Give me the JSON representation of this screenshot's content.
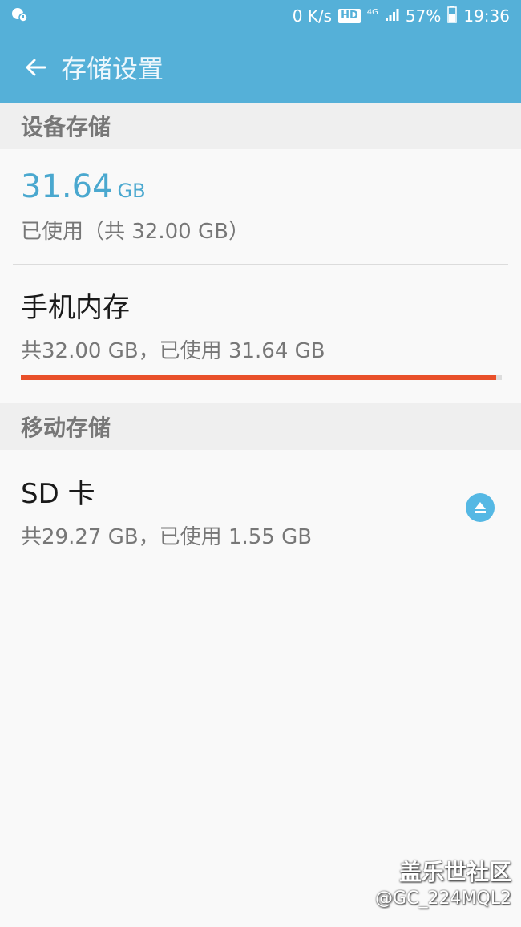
{
  "status_bar": {
    "speed": "0 K/s",
    "hd": "HD",
    "network": "4G",
    "battery": "57%",
    "time": "19:36"
  },
  "app_bar": {
    "title": "存储设置"
  },
  "sections": {
    "device": "设备存储",
    "removable": "移动存储"
  },
  "device_storage": {
    "used_value": "31.64",
    "used_unit": "GB",
    "used_label": "已使用（共 32.00 GB）"
  },
  "phone_memory": {
    "title": "手机内存",
    "detail": "共32.00 GB，已使用 31.64 GB",
    "used_fraction": 0.989
  },
  "sd_card": {
    "title": "SD 卡",
    "detail": "共29.27 GB，已使用 1.55 GB"
  },
  "watermark": {
    "line1": "盖乐世社区",
    "line2": "@GC_224MQL2"
  },
  "colors": {
    "accent": "#55b0d8",
    "progress": "#e9502a"
  },
  "icons": {
    "back": "arrow-left-icon",
    "eject": "eject-icon"
  }
}
